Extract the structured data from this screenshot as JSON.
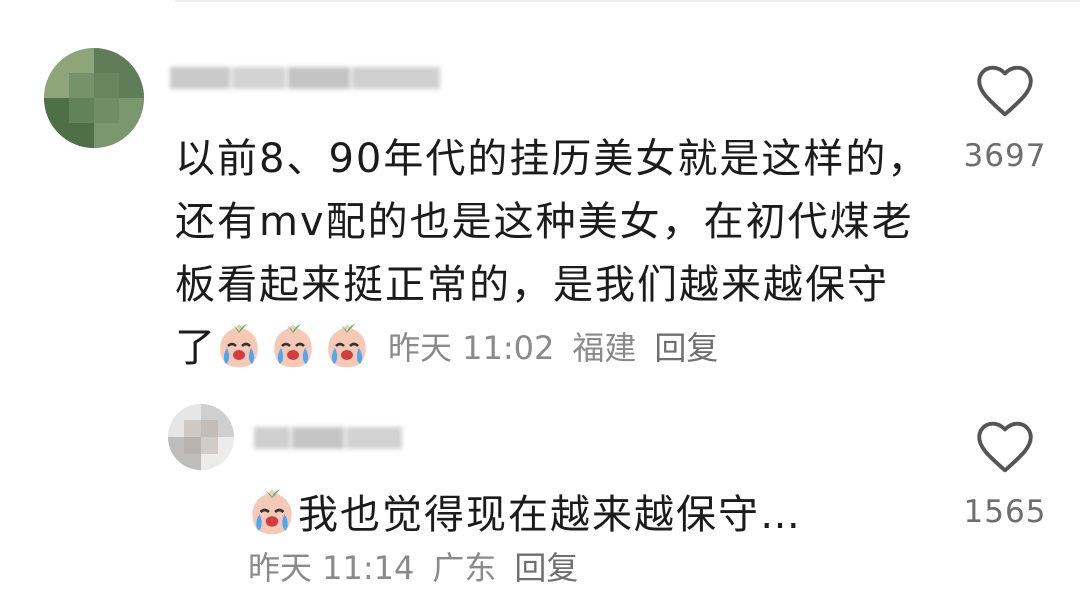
{
  "comments": [
    {
      "text": "以前8、90年代的挂历美女就是这样的，\n还有mv配的也是这种美女，在初代煤老\n板看起来挺正常的，是我们越来越保守\n了",
      "time": "昨天 11:02",
      "location": "福建",
      "reply_label": "回复",
      "likes": "3697"
    }
  ],
  "replies": [
    {
      "text": "我也觉得现在越来越保守…",
      "time": "昨天 11:14",
      "location": "广东",
      "reply_label": "回复",
      "likes": "1565"
    }
  ],
  "icons": {
    "like": "heart-outline-icon",
    "emoji": "crying-peach-emoji"
  },
  "colors": {
    "text_primary": "#1b1b1b",
    "text_meta": "#8a8a8a",
    "icon_stroke": "#555555"
  }
}
